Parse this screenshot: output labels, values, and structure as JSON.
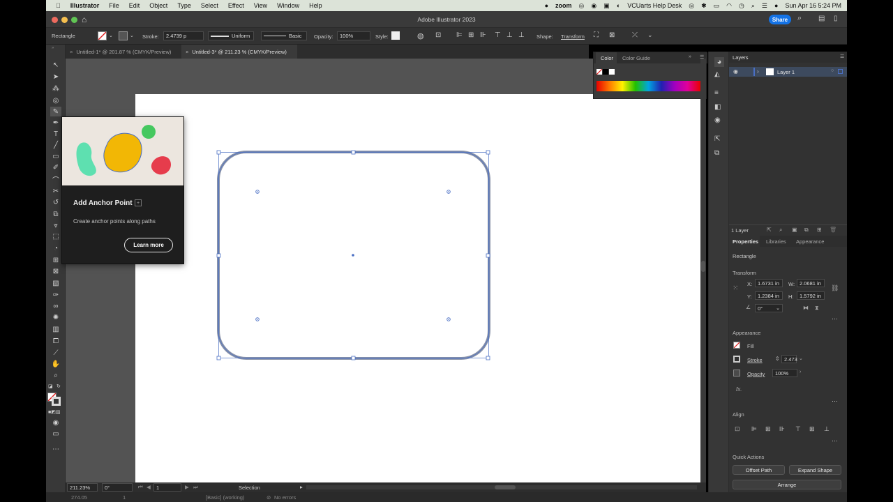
{
  "menubar": {
    "app": "Illustrator",
    "items": [
      "File",
      "Edit",
      "Object",
      "Type",
      "Select",
      "Effect",
      "View",
      "Window",
      "Help"
    ],
    "zoom_label": "zoom",
    "helpdesk": "VCUarts Help Desk",
    "datetime": "Sun Apr 16  5:24 PM"
  },
  "window": {
    "title": "Adobe Illustrator 2023",
    "share_label": "Share"
  },
  "control_bar": {
    "selection_type": "Rectangle",
    "stroke_label": "Stroke:",
    "stroke_value": "2.4739 p",
    "profile_value": "Uniform",
    "brush_value": "Basic",
    "opacity_label": "Opacity:",
    "opacity_value": "100%",
    "style_label": "Style:",
    "shape_label": "Shape:",
    "transform_label": "Transform"
  },
  "tabs": [
    {
      "label": "Untitled-1* @ 201.87 % (CMYK/Preview)",
      "active": false
    },
    {
      "label": "Untitled-3* @ 211.23 % (CMYK/Preview)",
      "active": true
    }
  ],
  "tooltip": {
    "title": "Add Anchor Point",
    "shortcut": "+",
    "description": "Create anchor points along paths",
    "button": "Learn more"
  },
  "color_panel": {
    "tabs": [
      "Color",
      "Color Guide"
    ]
  },
  "layers_panel": {
    "title": "Layers",
    "layer_name": "Layer 1",
    "count": "1 Layer"
  },
  "properties": {
    "tabs": [
      "Properties",
      "Libraries",
      "Appearance"
    ],
    "object_type": "Rectangle",
    "transform": {
      "title": "Transform",
      "x_label": "X:",
      "x": "1.6731 in",
      "y_label": "Y:",
      "y": "1.2384 in",
      "w_label": "W:",
      "w": "2.0681 in",
      "h_label": "H:",
      "h": "1.5792 in",
      "angle": "0°"
    },
    "appearance": {
      "title": "Appearance",
      "fill_label": "Fill",
      "stroke_label": "Stroke",
      "stroke_value": "2.473",
      "opacity_label": "Opacity",
      "opacity_value": "100%",
      "fx_label": "fx."
    },
    "align_title": "Align",
    "quick_actions": {
      "title": "Quick Actions",
      "offset_path": "Offset Path",
      "expand_shape": "Expand Shape",
      "arrange": "Arrange"
    }
  },
  "status_bar": {
    "zoom": "211.23%",
    "angle": "0°",
    "artboard": "1",
    "tool": "Selection"
  },
  "bottom_strip": {
    "zoom": "274.05",
    "artboard": "1",
    "swatch": "[Basic] (working)",
    "errors": "No errors"
  },
  "colors": {
    "selection": "#4a6fc4",
    "shape_stroke": "#8a93a8",
    "accent": "#1473e6"
  }
}
